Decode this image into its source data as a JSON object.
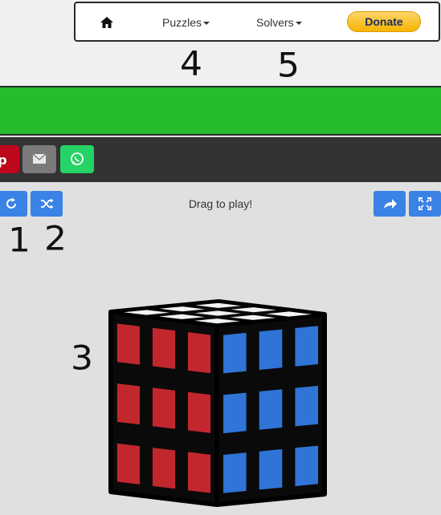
{
  "nav": {
    "home_icon": "home-icon",
    "puzzles_label": "Puzzles",
    "solvers_label": "Solvers",
    "donate_label": "Donate"
  },
  "annotations": [
    "4",
    "5",
    "1",
    "2",
    "3"
  ],
  "share": {
    "buttons": [
      {
        "icon": "pinterest-icon",
        "color": "#bd081c"
      },
      {
        "icon": "email-icon",
        "color": "#7a7a7a"
      },
      {
        "icon": "whatsapp-icon",
        "color": "#25d366"
      }
    ]
  },
  "toolbar": {
    "status_text": "Drag to play!",
    "left_buttons": [
      "reset-icon",
      "shuffle-icon"
    ],
    "right_buttons": [
      "share-icon",
      "fullscreen-icon"
    ],
    "accent": "#3b82e6"
  },
  "cube": {
    "top_color": "#f2f2f2",
    "left_color": "#c1272d",
    "right_color": "#2f74d6"
  },
  "colors": {
    "green_bar": "#27bb2e",
    "share_bar": "#333333",
    "page_bg": "#e0e0e0"
  }
}
